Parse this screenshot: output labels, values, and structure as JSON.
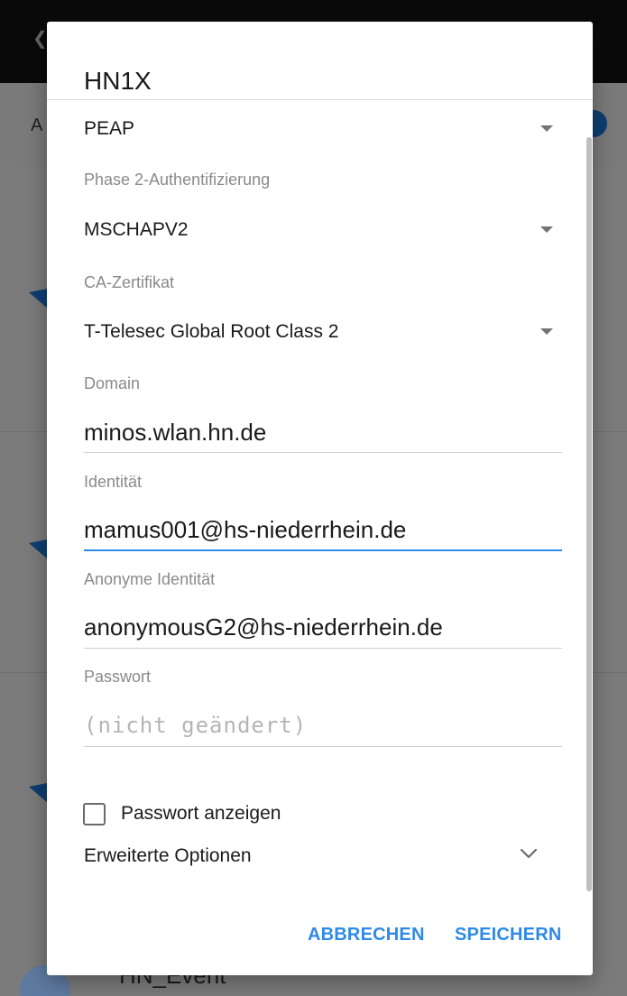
{
  "background": {
    "subheader_label": "A",
    "list_item_label": "HN_Event"
  },
  "dialog": {
    "title": "HN1X",
    "eap_method": "PEAP",
    "phase2": {
      "label": "Phase 2-Authentifizierung",
      "value": "MSCHAPV2"
    },
    "ca_cert": {
      "label": "CA-Zertifikat",
      "value": "T-Telesec Global Root Class 2"
    },
    "domain": {
      "label": "Domain",
      "value": "minos.wlan.hn.de"
    },
    "identity": {
      "label": "Identität",
      "value": "mamus001@hs-niederrhein.de"
    },
    "anon_identity": {
      "label": "Anonyme Identität",
      "value": "anonymousG2@hs-niederrhein.de"
    },
    "password": {
      "label": "Passwort",
      "placeholder": "(nicht geändert)",
      "value": ""
    },
    "show_password_label": "Passwort anzeigen",
    "show_password_checked": false,
    "advanced_label": "Erweiterte Optionen",
    "cancel_label": "ABBRECHEN",
    "save_label": "SPEICHERN"
  },
  "colors": {
    "accent": "#2f8ae6",
    "scrim": "#7b7b7b",
    "appbar": "#0a0a0a"
  }
}
